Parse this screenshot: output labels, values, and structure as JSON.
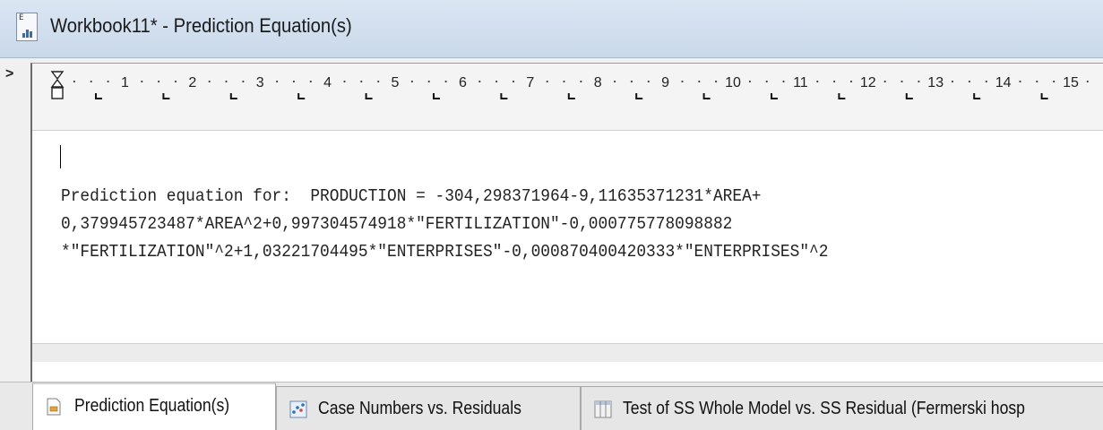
{
  "window": {
    "title": "Workbook11* - Prediction Equation(s)",
    "icon": "workbook-icon",
    "icon_tag": "E"
  },
  "margin_marker": ">",
  "ruler": {
    "numbers": [
      "1",
      "2",
      "3",
      "4",
      "5",
      "6",
      "7",
      "8",
      "9",
      "10",
      "11",
      "12",
      "13",
      "14",
      "15"
    ]
  },
  "document": {
    "equation_lines": [
      "Prediction equation for:  PRODUCTION = -304,298371964-9,11635371231*AREA+",
      "0,379945723487*AREA^2+0,997304574918*\"FERTILIZATION\"-0,000775778098882",
      "*\"FERTILIZATION\"^2+1,03221704495*\"ENTERPRISES\"-0,000870400420333*\"ENTERPRISES\"^2"
    ]
  },
  "tabs": [
    {
      "label": "Prediction Equation(s)",
      "icon": "document-icon",
      "active": true
    },
    {
      "label": "Case Numbers vs. Residuals",
      "icon": "scatter-chart-icon",
      "active": false
    },
    {
      "label": "Test of SS Whole Model vs. SS Residual (Fermerski hosp",
      "icon": "spreadsheet-icon",
      "active": false
    }
  ],
  "colors": {
    "titlebar": "#c9d8ea",
    "document_bg": "#ffffff",
    "tab_strip": "#e9e9e9"
  }
}
